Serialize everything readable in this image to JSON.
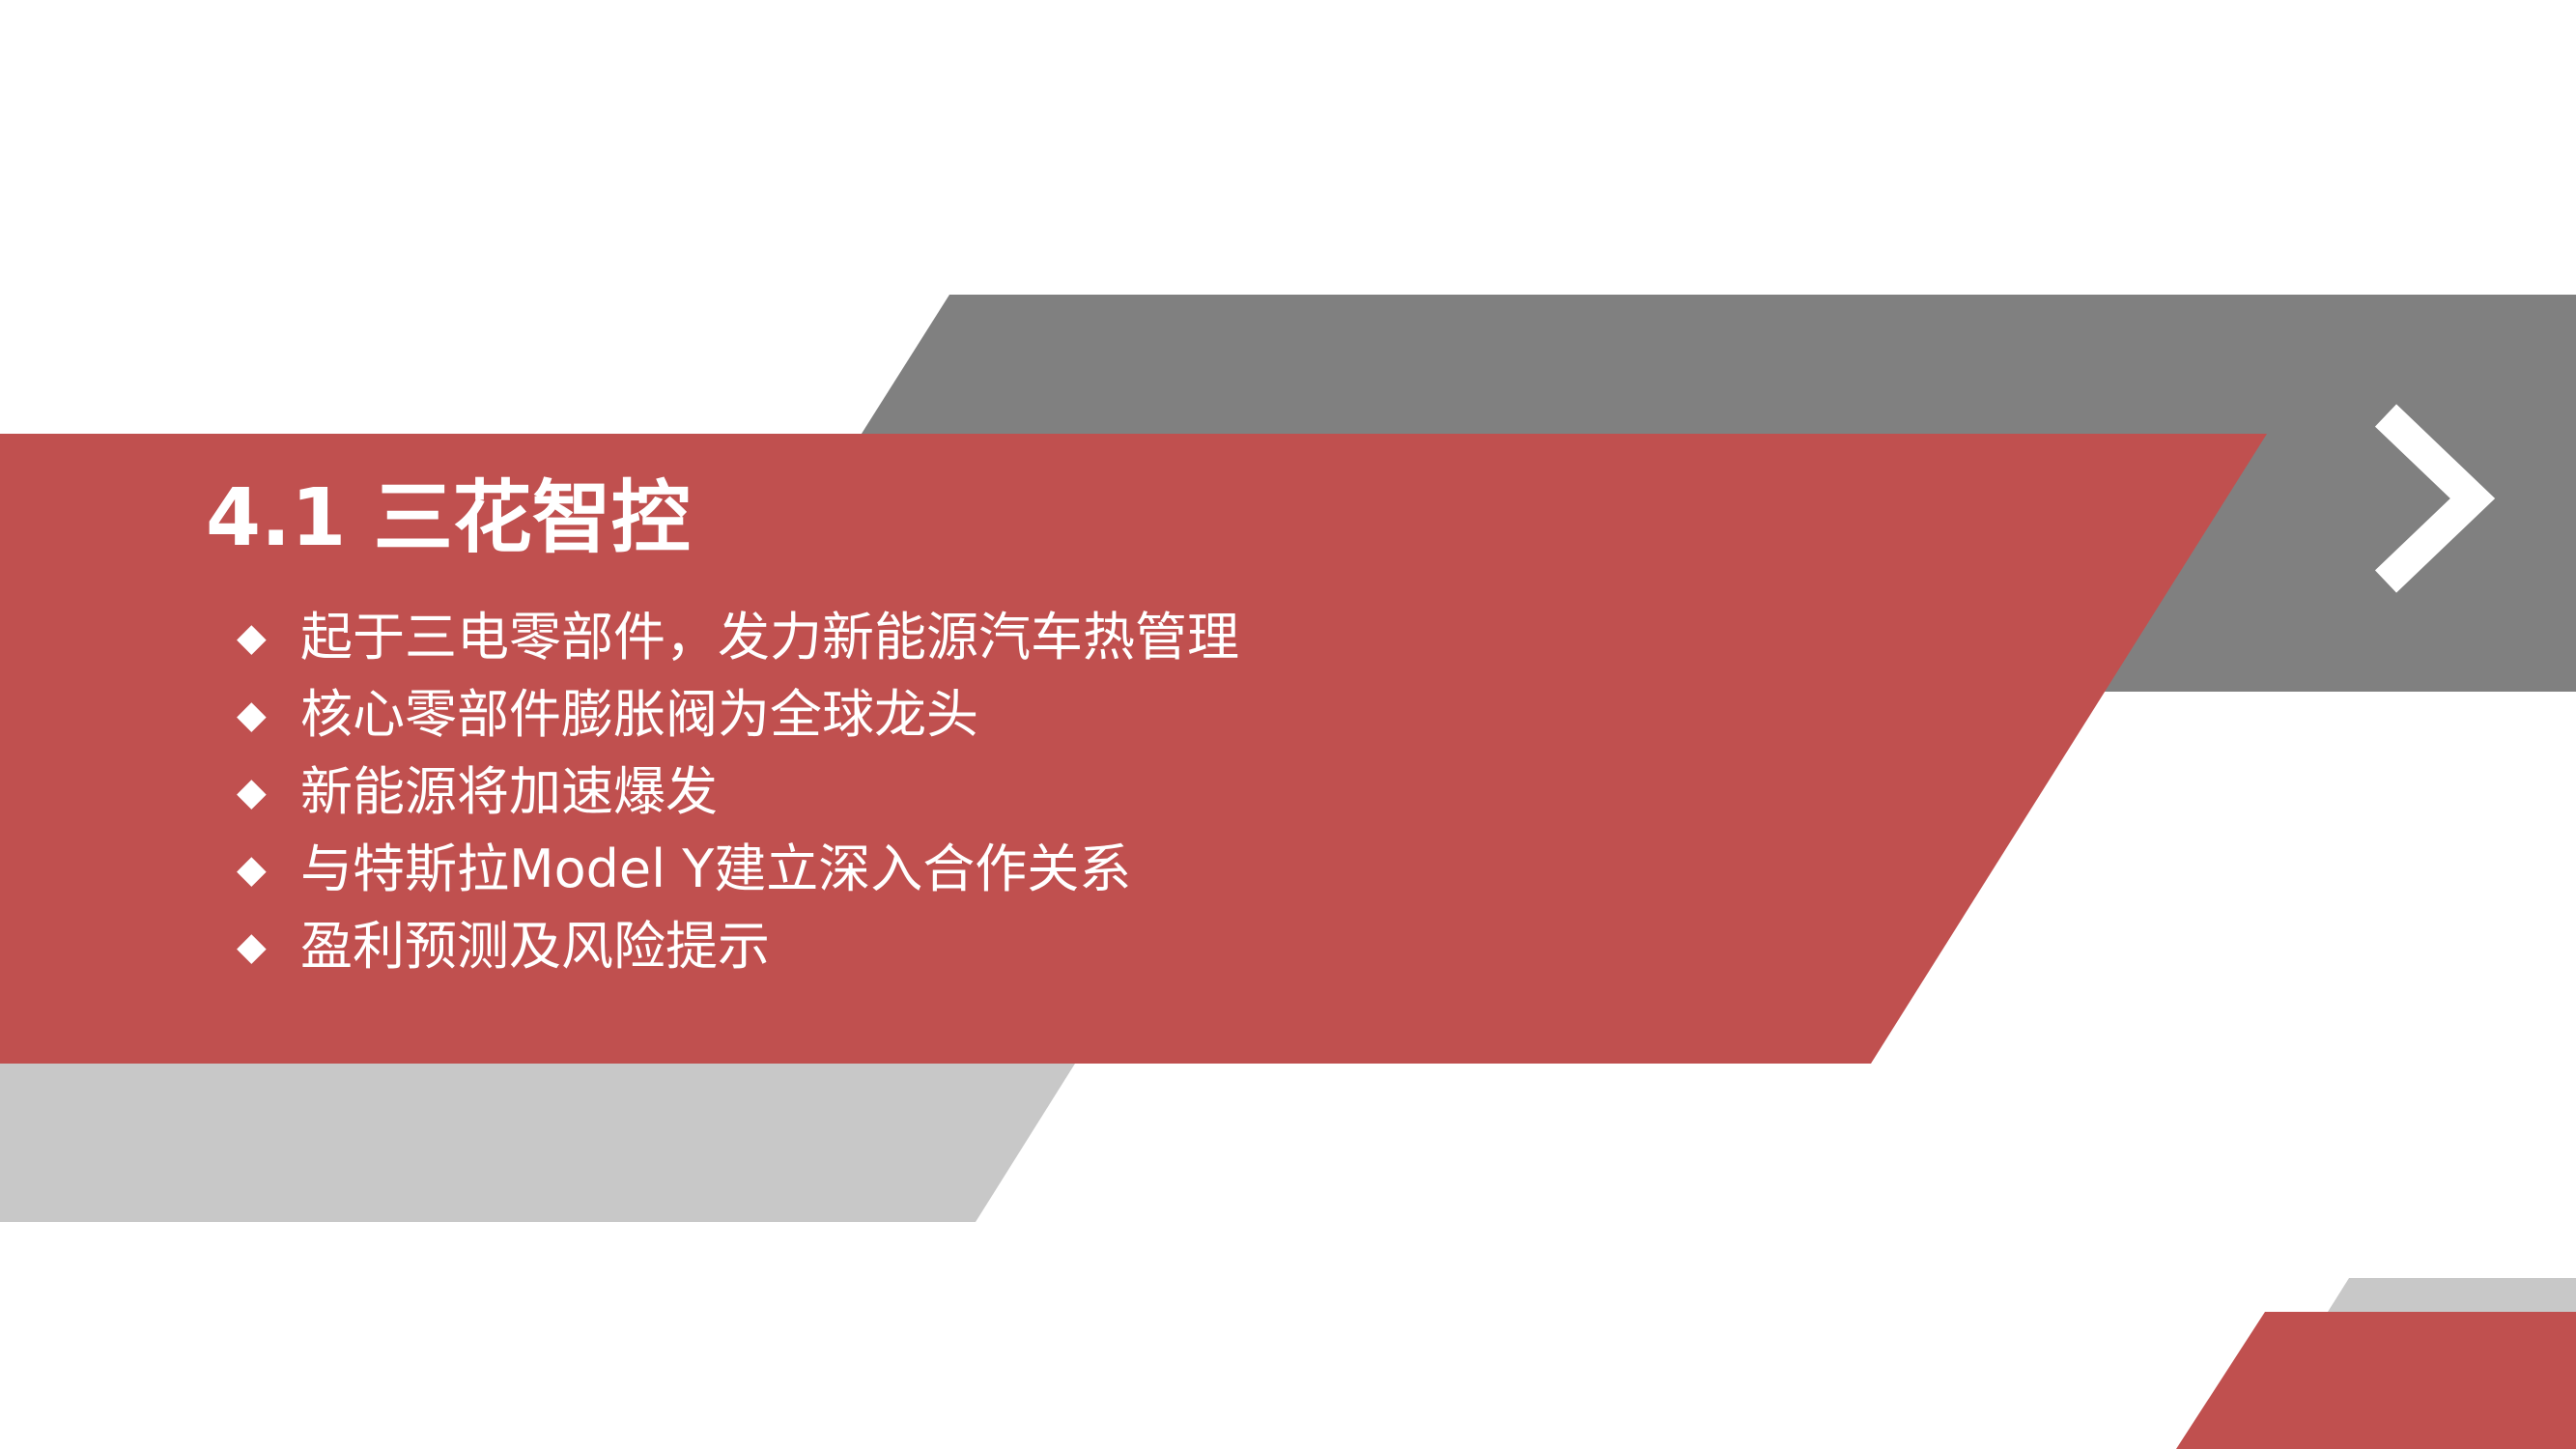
{
  "slide": {
    "title": "4.1 三花智控",
    "bullet_glyph": "◆",
    "items": [
      {
        "label": "起于三电零部件，发力新能源汽车热管理"
      },
      {
        "label": "核心零部件膨胀阀为全球龙头"
      },
      {
        "label": "新能源将加速爆发"
      },
      {
        "label": "与特斯拉Model Y建立深入合作关系"
      },
      {
        "label": "盈利预测及风险提示"
      }
    ],
    "next_icon": "chevron-right-icon"
  },
  "colors": {
    "accent_red": "#C0504F",
    "dark_gray": "#808080",
    "light_gray": "#C8C8C8",
    "text": "#FFFFFF",
    "background": "#FFFFFF"
  }
}
